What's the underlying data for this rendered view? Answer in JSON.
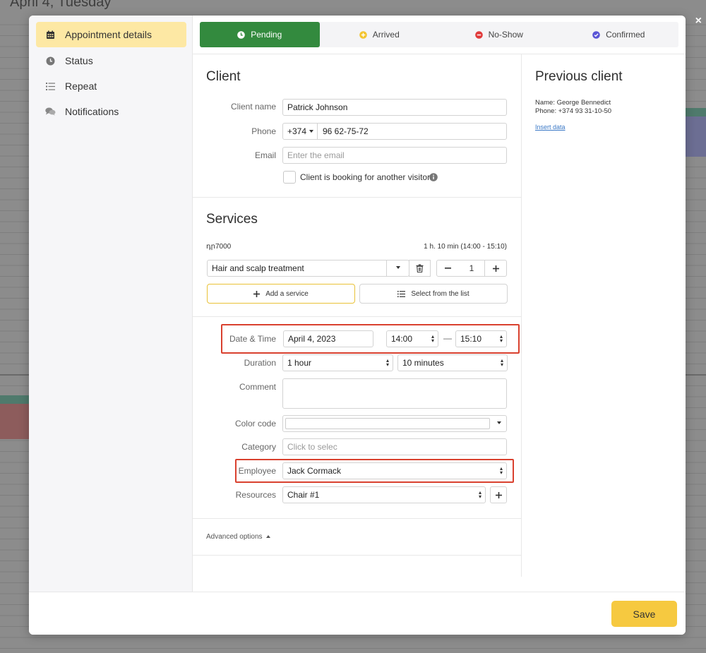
{
  "background": {
    "date_heading": "April 4, Tuesday"
  },
  "sidebar": {
    "items": [
      {
        "label": "Appointment details",
        "icon": "calendar-icon",
        "active": true
      },
      {
        "label": "Status",
        "icon": "clock-icon",
        "active": false
      },
      {
        "label": "Repeat",
        "icon": "list-icon",
        "active": false
      },
      {
        "label": "Notifications",
        "icon": "chat-icon",
        "active": false
      }
    ]
  },
  "status_tabs": [
    {
      "label": "Pending",
      "icon": "clock-icon",
      "color": "#338a3e",
      "active": true
    },
    {
      "label": "Arrived",
      "icon": "plus-circle-icon",
      "color": "#f3c42f",
      "active": false
    },
    {
      "label": "No-Show",
      "icon": "minus-circle-icon",
      "color": "#e03a3a",
      "active": false
    },
    {
      "label": "Confirmed",
      "icon": "check-circle-icon",
      "color": "#5a55d6",
      "active": false
    }
  ],
  "client": {
    "title": "Client",
    "name_label": "Client name",
    "name_value": "Patrick Johnson",
    "phone_label": "Phone",
    "phone_code": "+374",
    "phone_value": "96 62-75-72",
    "email_label": "Email",
    "email_placeholder": "Enter the email",
    "another_visitor_label": "Client is booking for another visitor"
  },
  "services": {
    "title": "Services",
    "price": "դր7000",
    "duration_summary": "1 h. 10 min (14:00 - 15:10)",
    "service_name": "Hair and scalp treatment",
    "quantity": "1",
    "add_service_label": "Add a service",
    "select_list_label": "Select from the list"
  },
  "details": {
    "datetime_label": "Date & Time",
    "date_value": "April 4, 2023",
    "start_time": "14:00",
    "end_time": "15:10",
    "time_separator": "—",
    "duration_label": "Duration",
    "duration_hours": "1 hour",
    "duration_minutes": "10 minutes",
    "comment_label": "Comment",
    "comment_value": "",
    "color_label": "Color code",
    "category_label": "Category",
    "category_placeholder": "Click to selec",
    "employee_label": "Employee",
    "employee_value": "Jack Cormack",
    "resources_label": "Resources",
    "resources_value": "Chair #1"
  },
  "advanced_options": "Advanced options",
  "previous_client": {
    "title": "Previous client",
    "name_line": "Name: George Bennedict",
    "phone_line": "Phone: +374 93 31-10-50",
    "insert_link": "Insert data"
  },
  "footer": {
    "save_label": "Save"
  },
  "close_label": "×",
  "highlight_color": "#d9412f"
}
